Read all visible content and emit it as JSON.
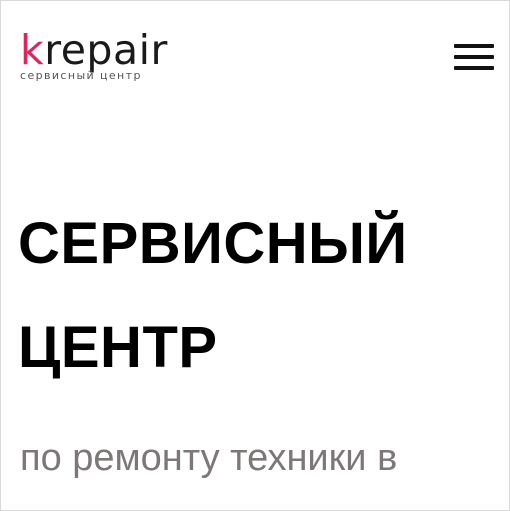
{
  "brand": {
    "logo_accent": "k",
    "logo_rest": "repair",
    "tagline": "сервисный центр",
    "accent_color": "#e0245e"
  },
  "header": {
    "menu_icon": "hamburger-menu-icon"
  },
  "hero": {
    "title_line1": "СЕРВИСНЫЙ",
    "title_line2": "ЦЕНТР",
    "subtitle": "по ремонту техники в"
  }
}
